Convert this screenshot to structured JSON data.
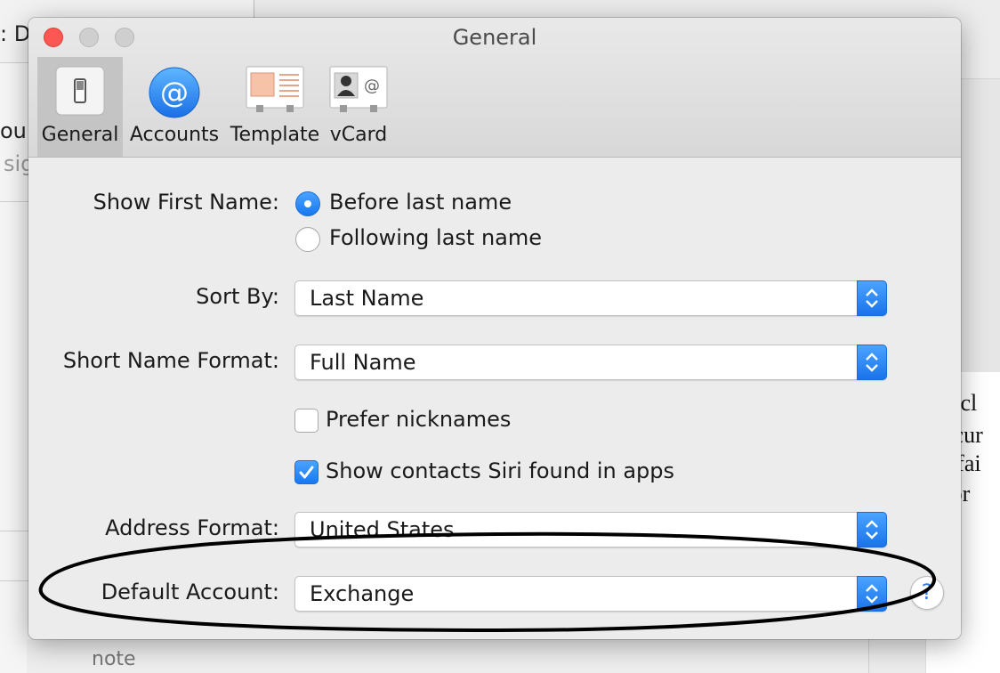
{
  "background": {
    "left_fragments": [
      ": D",
      "our",
      "sig"
    ],
    "right_fragments": [
      "y cl",
      "ecur",
      "r fai",
      "for"
    ],
    "bottom_note": "note"
  },
  "window": {
    "title": "General",
    "tabs": [
      {
        "label": "General",
        "icon": "switch-icon",
        "active": true
      },
      {
        "label": "Accounts",
        "icon": "at-sign-icon",
        "active": false
      },
      {
        "label": "Template",
        "icon": "template-card-icon",
        "active": false
      },
      {
        "label": "vCard",
        "icon": "vcard-icon",
        "active": false
      }
    ]
  },
  "settings": {
    "show_first_name": {
      "label": "Show First Name:",
      "options": [
        "Before last name",
        "Following last name"
      ],
      "selected": "Before last name"
    },
    "sort_by": {
      "label": "Sort By:",
      "value": "Last Name"
    },
    "short_name_format": {
      "label": "Short Name Format:",
      "value": "Full Name"
    },
    "prefer_nicknames": {
      "label": "Prefer nicknames",
      "checked": false
    },
    "siri_contacts": {
      "label": "Show contacts Siri found in apps",
      "checked": true
    },
    "address_format": {
      "label": "Address Format:",
      "value": "United States"
    },
    "default_account": {
      "label": "Default Account:",
      "value": "Exchange"
    },
    "help": "?"
  },
  "colors": {
    "accent": "#1778f2",
    "close_button": "#fc5753",
    "annotation_stroke": "#000000"
  }
}
